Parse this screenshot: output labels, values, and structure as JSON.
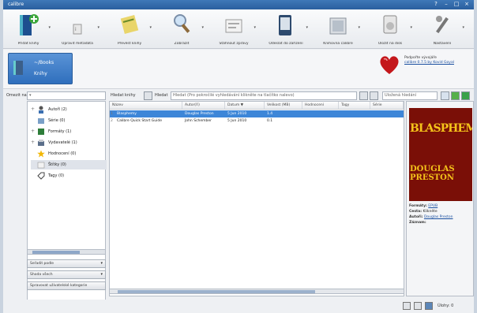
{
  "window": {
    "title": "calibre"
  },
  "toolbar": {
    "items": [
      {
        "label": "Přidat knihy"
      },
      {
        "label": "Upravit metadata"
      },
      {
        "label": "Převést knihy"
      },
      {
        "label": "Zobrazit"
      },
      {
        "label": "Stáhnout zprávy"
      },
      {
        "label": "Odeslat do zařízení"
      },
      {
        "label": "Knihovna calibre"
      },
      {
        "label": "Uložit na disk"
      },
      {
        "label": "Nastavení"
      }
    ]
  },
  "library": {
    "line1": "~/Books",
    "line2": "Knihy"
  },
  "donate": {
    "text": "Podpořte vývojáře",
    "link": "calibre 0.7.5 by Kovid Goyal"
  },
  "searchbar": {
    "restrict_label": "Omezit na:",
    "group_label": "Hledat knihy",
    "search_label": "Hledat",
    "search_placeholder": "Hledat (Pro pokročilé vyhledávání klikněte na tlačítko nalevo)",
    "saved_placeholder": "Uložená hledání"
  },
  "tags": [
    {
      "label": "Autoři (2)"
    },
    {
      "label": "Série (0)"
    },
    {
      "label": "Formáty (1)"
    },
    {
      "label": "Vydavatelé (1)"
    },
    {
      "label": "Hodnocení (0)"
    },
    {
      "label": "Štítky (0)"
    },
    {
      "label": "Tagy (0)"
    }
  ],
  "left_bottom": {
    "sort_label": "Seřadit podle",
    "match_label": "Shoda všech",
    "manage_label": "Spravovat uživatelské kategorie"
  },
  "columns": [
    {
      "label": "Název"
    },
    {
      "label": "Autor(ři)"
    },
    {
      "label": "Datum ▼"
    },
    {
      "label": "Velikost (MB)"
    },
    {
      "label": "Hodnocení"
    },
    {
      "label": "Tagy"
    },
    {
      "label": "Série"
    }
  ],
  "books": [
    {
      "num": "1",
      "title": "Blasphemy",
      "author": "Douglas Preston",
      "date": "5 Jun 2010",
      "size": "1.4",
      "selected": true
    },
    {
      "num": "2",
      "title": "Calibre Quick Start Guide",
      "author": "John Schember",
      "date": "5 Jun 2010",
      "size": "0.1",
      "selected": false
    }
  ],
  "detail": {
    "cover_title": "BLASPHEMY",
    "cover_author": "DOUGLAS PRESTON",
    "formats_label": "Formáty:",
    "formats_value": "EPUB",
    "path_label": "Cesta:",
    "path_value": "Klikněte",
    "author_label": "Autoři:",
    "author_value": "Douglas Preston",
    "isbn_label": "Záznam:"
  },
  "status": {
    "jobs_label": "Úlohy: 0"
  },
  "colors": {
    "accent": "#3d86d8",
    "title_bar": "#2a5f9e",
    "cover_bg": "#7a0f07"
  }
}
